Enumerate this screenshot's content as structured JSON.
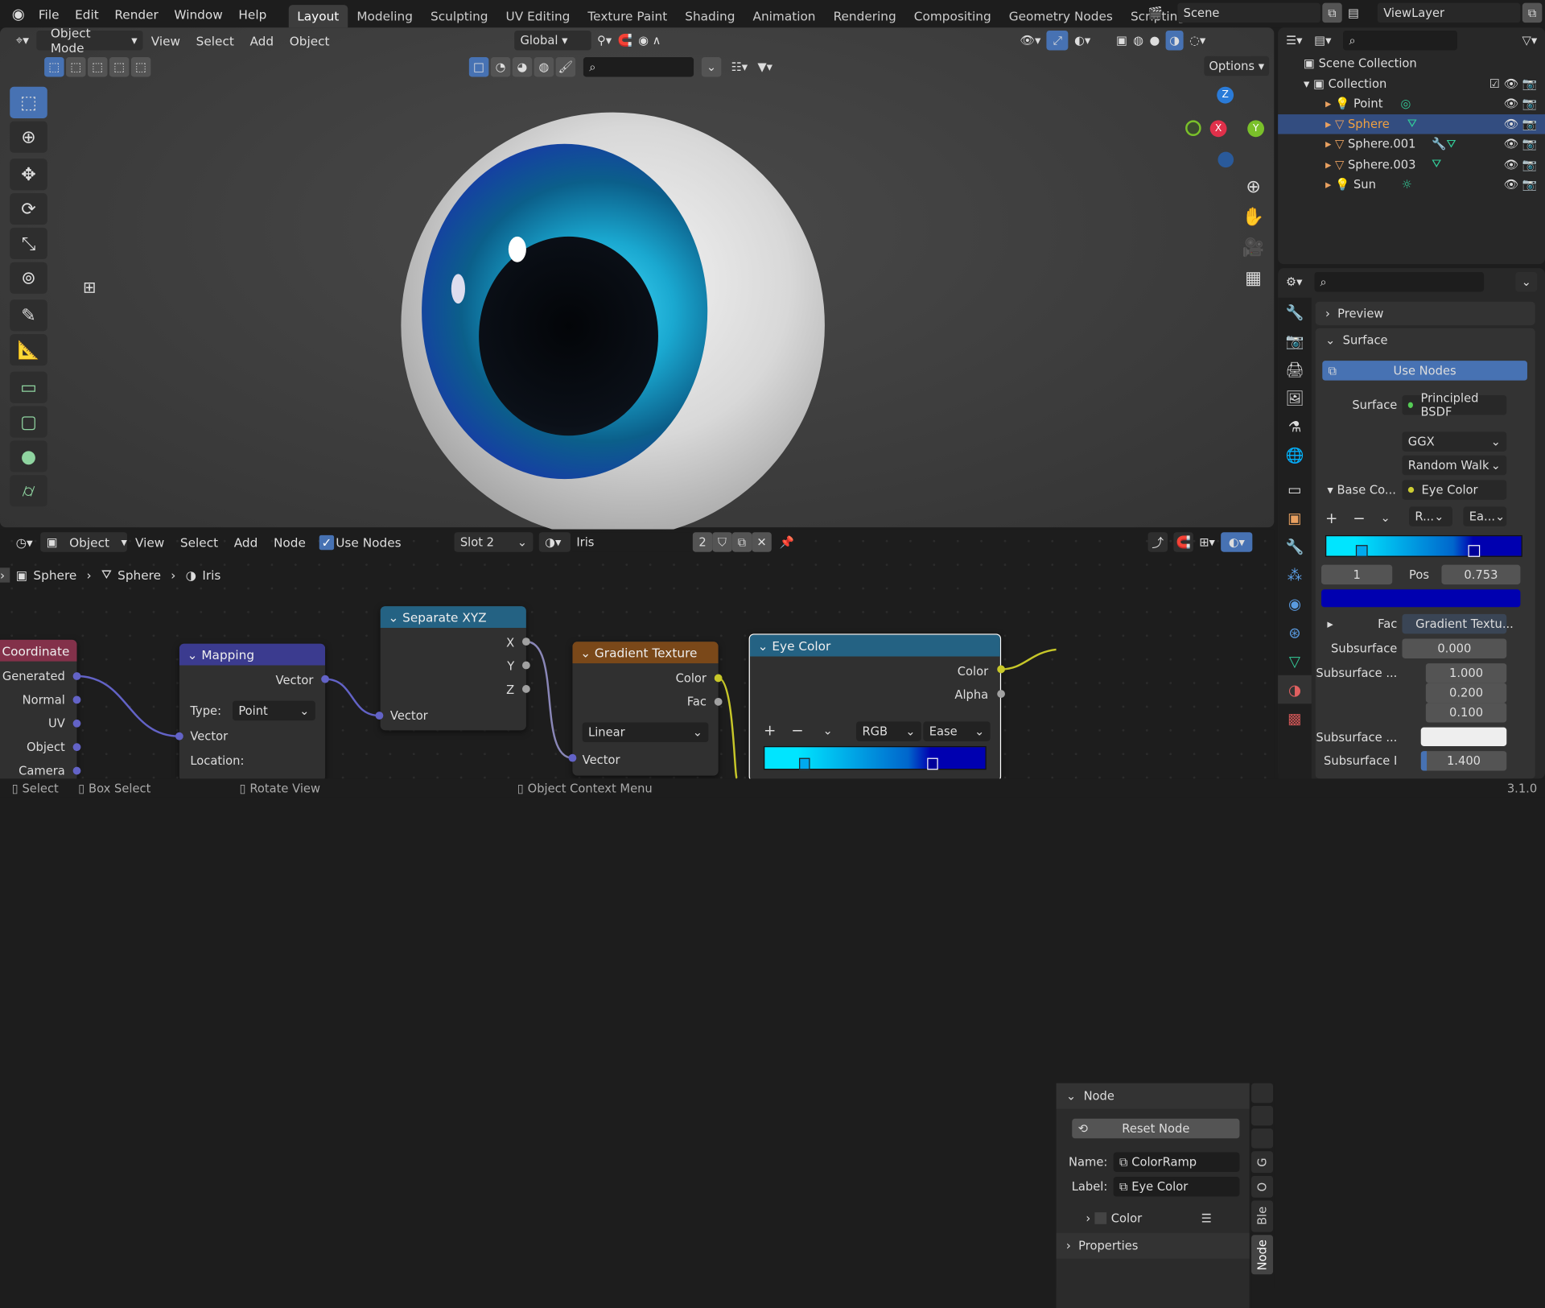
{
  "topbar": {
    "menus": [
      "File",
      "Edit",
      "Render",
      "Window",
      "Help"
    ],
    "workspaces": [
      "Layout",
      "Modeling",
      "Sculpting",
      "UV Editing",
      "Texture Paint",
      "Shading",
      "Animation",
      "Rendering",
      "Compositing",
      "Geometry Nodes",
      "Scripting"
    ],
    "active_workspace": "Layout",
    "add_tab": "+",
    "scene": "Scene",
    "view_layer": "ViewLayer"
  },
  "viewport": {
    "mode": "Object Mode",
    "menus": [
      "View",
      "Select",
      "Add",
      "Object"
    ],
    "orientation": "Global",
    "options": "Options",
    "gizmo": {
      "z": "Z",
      "x": "X",
      "y": "Y"
    }
  },
  "outliner": {
    "root": "Scene Collection",
    "collection": "Collection",
    "items": [
      {
        "name": "Point",
        "selected": false
      },
      {
        "name": "Sphere",
        "selected": true
      },
      {
        "name": "Sphere.001",
        "selected": false
      },
      {
        "name": "Sphere.003",
        "selected": false
      },
      {
        "name": "Sun",
        "selected": false
      }
    ]
  },
  "properties": {
    "preview": "Preview",
    "surface_panel": "Surface",
    "use_nodes": "Use Nodes",
    "surface_label": "Surface",
    "surface_value": "Principled BSDF",
    "distribution": "GGX",
    "subsurface_method": "Random Walk",
    "base_color_label": "Base Co...",
    "base_color_value": "Eye Color",
    "ramp_plus": "+",
    "ramp_minus": "−",
    "ramp_mode": "R...",
    "ramp_interp": "Ea...",
    "stop_index": "1",
    "pos_label": "Pos",
    "pos_value": "0.753",
    "stop_color": "#0000b0",
    "fac_label": "Fac",
    "fac_value": "Gradient Textu...",
    "subsurface_label": "Subsurface",
    "subsurface_value": "0.000",
    "subsurface_radius_label": "Subsurface ...",
    "subsurface_radius": [
      "1.000",
      "0.200",
      "0.100"
    ],
    "subsurface_color_label": "Subsurface ...",
    "subsurface_ior_label": "Subsurface I",
    "subsurface_ior_value": "1.400",
    "subsurface_ior_fraction": 0.07
  },
  "node_editor": {
    "type": "Object",
    "menus": [
      "View",
      "Select",
      "Add",
      "Node"
    ],
    "use_nodes": "Use Nodes",
    "slot": "Slot 2",
    "material": "Iris",
    "users": "2",
    "breadcrumb": [
      "Sphere",
      "Sphere",
      "Iris"
    ],
    "nodes": {
      "coordinate": {
        "title": "Coordinate",
        "outputs": [
          "Generated",
          "Normal",
          "UV",
          "Object",
          "Camera"
        ]
      },
      "mapping": {
        "title": "Mapping",
        "output": "Vector",
        "type_label": "Type:",
        "type_value": "Point",
        "input": "Vector",
        "location": "Location:"
      },
      "separate": {
        "title": "Separate XYZ",
        "outputs": [
          "X",
          "Y",
          "Z"
        ],
        "input": "Vector"
      },
      "gradient": {
        "title": "Gradient Texture",
        "outputs": [
          "Color",
          "Fac"
        ],
        "mode": "Linear",
        "input": "Vector"
      },
      "eye_color": {
        "title": "Eye Color",
        "outputs": [
          "Color",
          "Alpha"
        ],
        "plus": "+",
        "minus": "−",
        "color_mode": "RGB",
        "interp": "Ease"
      }
    },
    "side_panel": {
      "node_header": "Node",
      "reset": "Reset Node",
      "name_label": "Name:",
      "name_value": "ColorRamp",
      "label_label": "Label:",
      "label_value": "Eye Color",
      "color_section": "Color",
      "properties": "Properties",
      "tabs": [
        "Node",
        "Ble",
        "O",
        "G"
      ]
    }
  },
  "status": {
    "select": "Select",
    "box_select": "Box Select",
    "rotate": "Rotate View",
    "context": "Object Context Menu",
    "version": "3.1.0"
  }
}
